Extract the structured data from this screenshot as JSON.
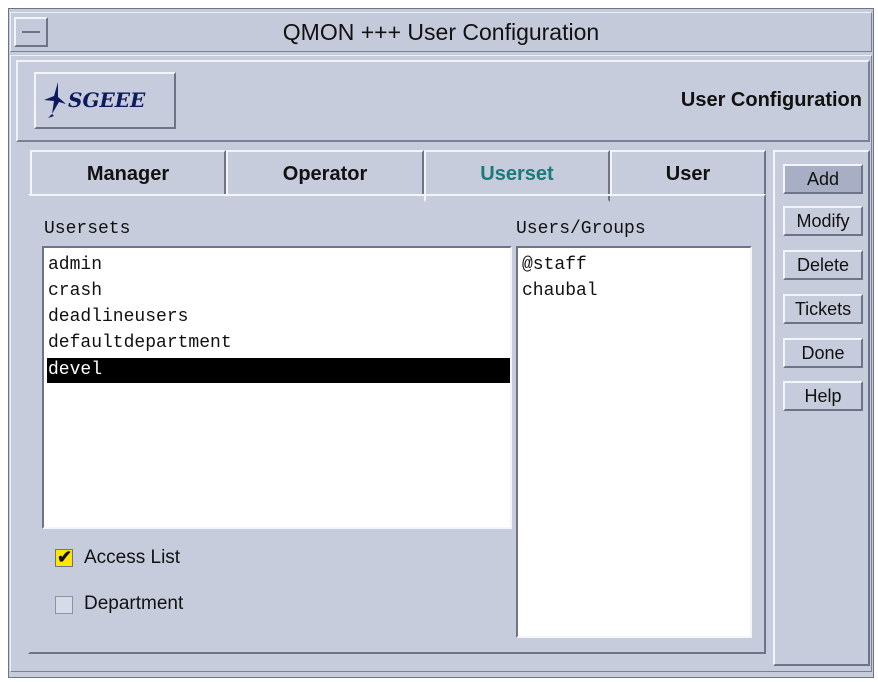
{
  "window": {
    "title": "QMON +++ User Configuration"
  },
  "header": {
    "logo_text": "SGEEE",
    "title": "User Configuration"
  },
  "tabs": [
    {
      "label": "Manager"
    },
    {
      "label": "Operator"
    },
    {
      "label": "Userset",
      "active": true
    },
    {
      "label": "User"
    }
  ],
  "usersets": {
    "label": "Usersets",
    "items": [
      "admin",
      "crash",
      "deadlineusers",
      "defaultdepartment",
      "devel"
    ],
    "selected": "devel"
  },
  "users_groups": {
    "label": "Users/Groups",
    "items": [
      "@staff",
      "chaubal"
    ]
  },
  "options": [
    {
      "label": "Access List",
      "checked": true
    },
    {
      "label": "Department",
      "checked": false
    }
  ],
  "buttons": [
    "Add",
    "Modify",
    "Delete",
    "Tickets",
    "Done",
    "Help"
  ],
  "colors": {
    "background": "#c7ccdc",
    "active_tab_text": "#1a7a7a",
    "selection": "#000000",
    "checkbox_on": "#ffe600"
  }
}
